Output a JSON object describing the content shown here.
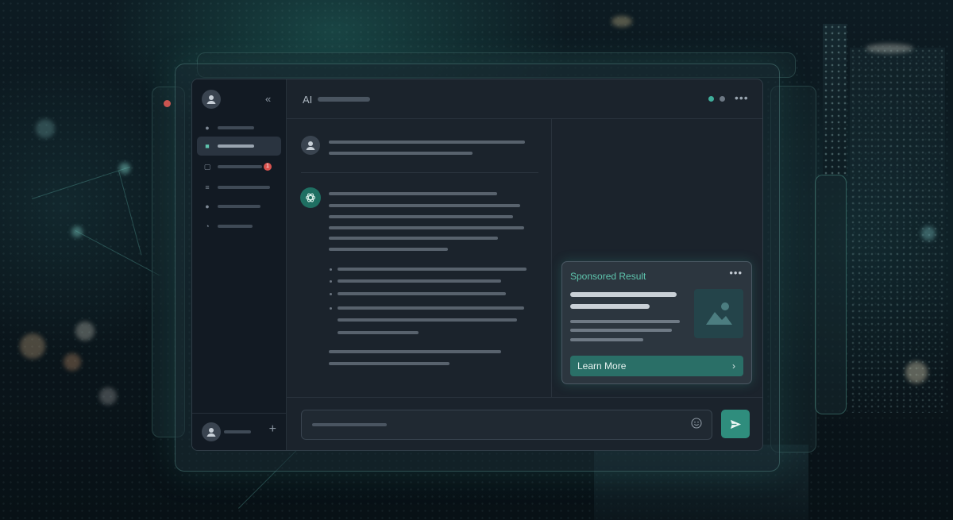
{
  "header": {
    "title": "AI",
    "more_icon": "more-horizontal-icon"
  },
  "sidebar": {
    "collapse_icon": "double-chevron-left-icon",
    "badge_count": "1",
    "add_icon": "plus-icon",
    "items": [
      {
        "icon": "user-icon"
      },
      {
        "icon": "chat-bubble-icon",
        "active": true
      },
      {
        "icon": "message-icon"
      },
      {
        "icon": "list-icon"
      },
      {
        "icon": "circle-icon"
      },
      {
        "icon": "clock-icon"
      }
    ]
  },
  "ad": {
    "label": "Sponsored Result",
    "cta": "Learn More",
    "image_icon": "image-placeholder-icon"
  },
  "composer": {
    "emoji_icon": "smiley-icon",
    "send_icon": "send-icon"
  },
  "colors": {
    "accent": "#2f8d7d",
    "accent_text": "#5ec4ad",
    "badge": "#d9534f",
    "background": "#0a151b"
  }
}
